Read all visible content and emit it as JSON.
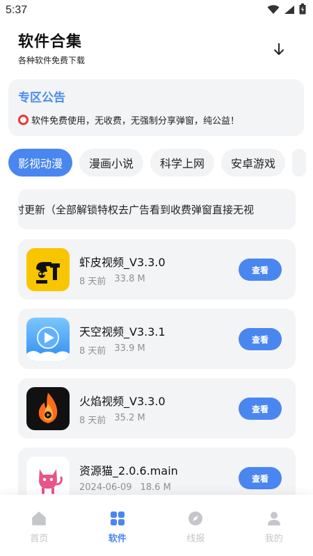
{
  "status": {
    "time": "5:37"
  },
  "header": {
    "title": "软件合集",
    "subtitle": "各种软件免费下载",
    "download_icon": "arrow-down-icon"
  },
  "notice": {
    "title": "专区公告",
    "body": "软件免费使用，无收费，无强制分享弹窗，纯公益！"
  },
  "tabs": [
    {
      "label": "影视动漫",
      "active": true
    },
    {
      "label": "漫画小说",
      "active": false
    },
    {
      "label": "科学上网",
      "active": false
    },
    {
      "label": "安卓游戏",
      "active": false
    }
  ],
  "marquee": {
    "text": "时更新（全部解锁特权去广告看到收费弹窗直接无视"
  },
  "apps": [
    {
      "name": "虾皮视频_V3.3.0",
      "date": "8 天前",
      "size": "33.8 M",
      "button": "查看",
      "icon": "shrimp-app-icon"
    },
    {
      "name": "天空视频_V3.3.1",
      "date": "8 天前",
      "size": "33.9 M",
      "button": "查看",
      "icon": "sky-play-app-icon"
    },
    {
      "name": "火焰视频_V3.3.0",
      "date": "8 天前",
      "size": "35.2 M",
      "button": "查看",
      "icon": "flame-app-icon"
    },
    {
      "name": "资源猫_2.0.6.main",
      "date": "2024-06-09",
      "size": "18.6 M",
      "button": "查看",
      "icon": "cat-app-icon"
    }
  ],
  "nav": [
    {
      "label": "首页",
      "icon": "home-icon",
      "active": false
    },
    {
      "label": "软件",
      "icon": "grid-icon",
      "active": true
    },
    {
      "label": "线报",
      "icon": "compass-icon",
      "active": false
    },
    {
      "label": "我的",
      "icon": "person-icon",
      "active": false
    }
  ],
  "colors": {
    "accent": "#4a86f0",
    "notice_title": "#4a8cf0",
    "card_bg": "#f3f4f6",
    "meta_text": "#8d9096",
    "inactive_nav": "#c4c6ca"
  }
}
